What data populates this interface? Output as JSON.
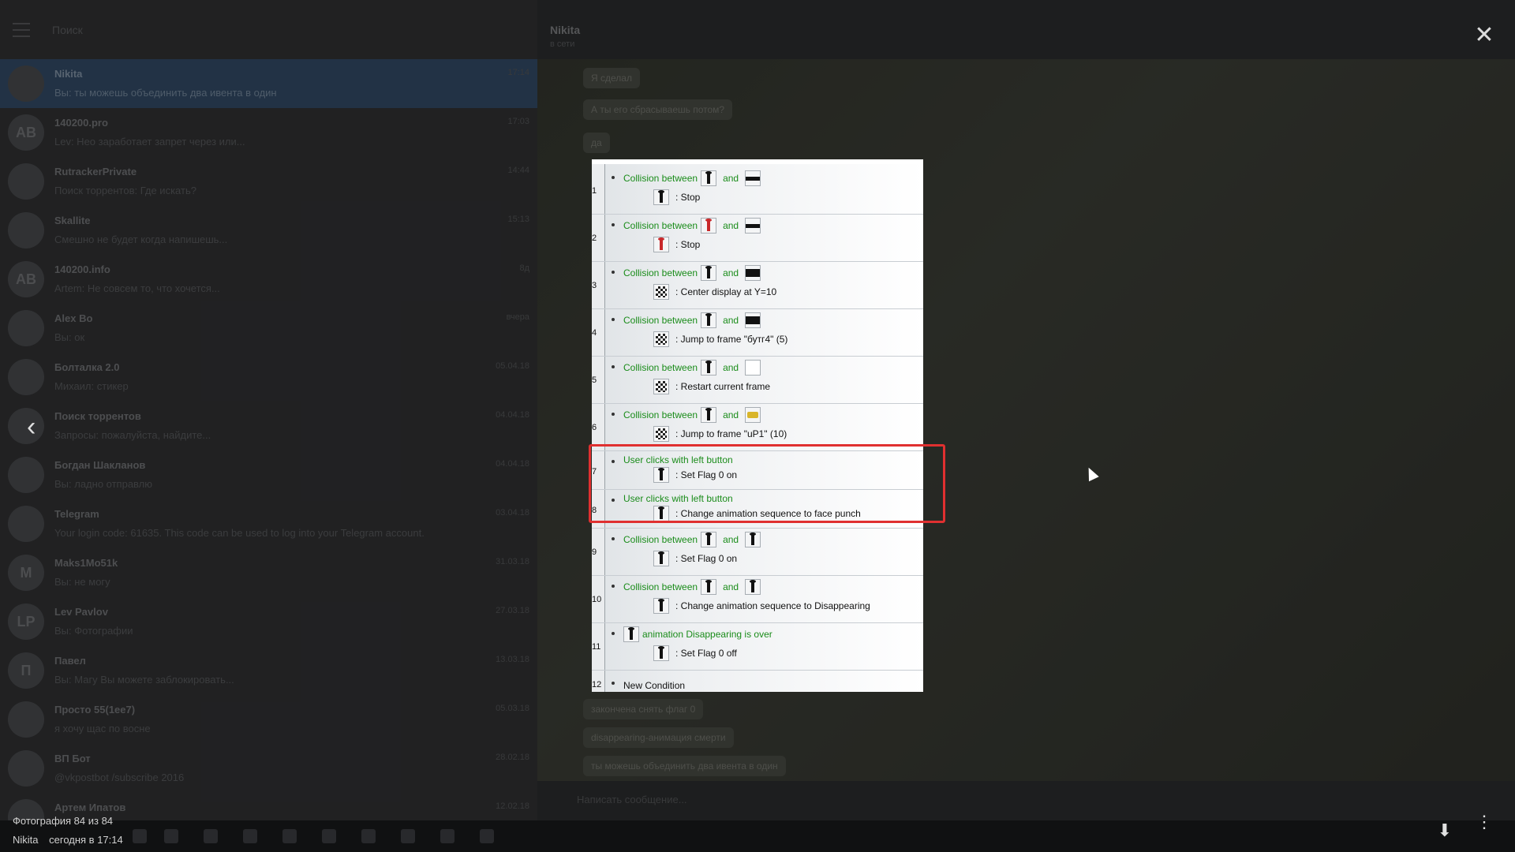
{
  "telegram": {
    "search_placeholder": "Поиск",
    "chats": [
      {
        "name": "Nikita",
        "time": "17:14",
        "preview": "Вы: ты можешь объединить два ивента в один",
        "initials": ""
      },
      {
        "name": "140200.pro",
        "time": "17:03",
        "preview": "Lev: Нео заработает запрет через или...",
        "initials": "AB"
      },
      {
        "name": "RutrackerPrivate",
        "time": "14:44",
        "preview": "Поиск торрентов: Где искать?",
        "initials": ""
      },
      {
        "name": "Skallite",
        "time": "15:13",
        "preview": "Смешно не будет когда напишешь...",
        "initials": ""
      },
      {
        "name": "140200.info",
        "time": "8д",
        "preview": "Artem: Не совсем то, что хочется...",
        "initials": "AB"
      },
      {
        "name": "Alex Bo",
        "time": "вчера",
        "preview": "Вы: ок",
        "initials": ""
      },
      {
        "name": "Болталка 2.0",
        "time": "05.04.18",
        "preview": "Михаил: стикер",
        "initials": ""
      },
      {
        "name": "Поиск торрентов",
        "time": "04.04.18",
        "preview": "Запросы: пожалуйста, найдите...",
        "initials": ""
      },
      {
        "name": "Богдан Шакланов",
        "time": "04.04.18",
        "preview": "Вы: ладно отправлю",
        "initials": ""
      },
      {
        "name": "Telegram",
        "time": "03.04.18",
        "preview": "Your login code: 61635. This code can be used to log into your Telegram account.",
        "initials": ""
      },
      {
        "name": "Maks1Mo51k",
        "time": "31.03.18",
        "preview": "Вы: не могу",
        "initials": "M"
      },
      {
        "name": "Lev Pavlov",
        "time": "27.03.18",
        "preview": "Вы: Фотографии",
        "initials": "LP"
      },
      {
        "name": "Павел",
        "time": "13.03.18",
        "preview": "Вы: Магу Вы можете заблокировать...",
        "initials": "П"
      },
      {
        "name": "Просто 55(1ee7)",
        "time": "05.03.18",
        "preview": "я хочу щас по восне",
        "initials": ""
      },
      {
        "name": "ВП Бот",
        "time": "28.02.18",
        "preview": "@vkpostbot /subscribe 2016",
        "initials": ""
      },
      {
        "name": "Артем Ипатов",
        "time": "12.02.18",
        "preview": "",
        "initials": ""
      }
    ],
    "header": {
      "title": "Nikita",
      "status": "в сети"
    },
    "messages": [
      "Я сделал",
      "А ты его сбрасываешь потом?",
      "да",
      "закончена снять флаг 0",
      "disappearing-анимация смерти",
      "ты можешь объединить два ивента в один"
    ],
    "composer_placeholder": "Написать сообщение...",
    "photo_viewer": {
      "counter": "Фотография 84 из 84",
      "sender": "Nikita",
      "date": "сегодня в 17:14",
      "close_glyph": "✕",
      "prev_glyph": "‹",
      "more_glyph": "⋮",
      "download_glyph": "⬇"
    }
  },
  "event_editor": {
    "rows": [
      {
        "num": "1",
        "cond": "Collision between",
        "and": "and",
        "action": ": Stop"
      },
      {
        "num": "2",
        "cond": "Collision between",
        "and": "and",
        "action": ": Stop"
      },
      {
        "num": "3",
        "cond": "Collision between",
        "and": "and",
        "action": ": Center display at Y=10"
      },
      {
        "num": "4",
        "cond": "Collision between",
        "and": "and",
        "action": ": Jump to frame \"бутг4\" (5)"
      },
      {
        "num": "5",
        "cond": "Collision between",
        "and": "and",
        "action": ": Restart current frame"
      },
      {
        "num": "6",
        "cond": "Collision between",
        "and": "and",
        "action": ": Jump to frame \"uP1\" (10)"
      },
      {
        "num": "7",
        "cond": "User clicks with left button",
        "action": ": Set Flag 0 on"
      },
      {
        "num": "8",
        "cond": "User clicks with left button",
        "action": ": Change animation sequence to face punch"
      },
      {
        "num": "9",
        "cond": "Collision between",
        "and": "and",
        "action": ": Set Flag 0 on"
      },
      {
        "num": "10",
        "cond": "Collision between",
        "and": "and",
        "action": ": Change animation sequence to Disappearing"
      },
      {
        "num": "11",
        "cond": "animation Disappearing is over",
        "action": ": Set Flag 0 off"
      },
      {
        "num": "12",
        "new": "New Condition"
      }
    ],
    "highlight_color": "#e03030"
  }
}
